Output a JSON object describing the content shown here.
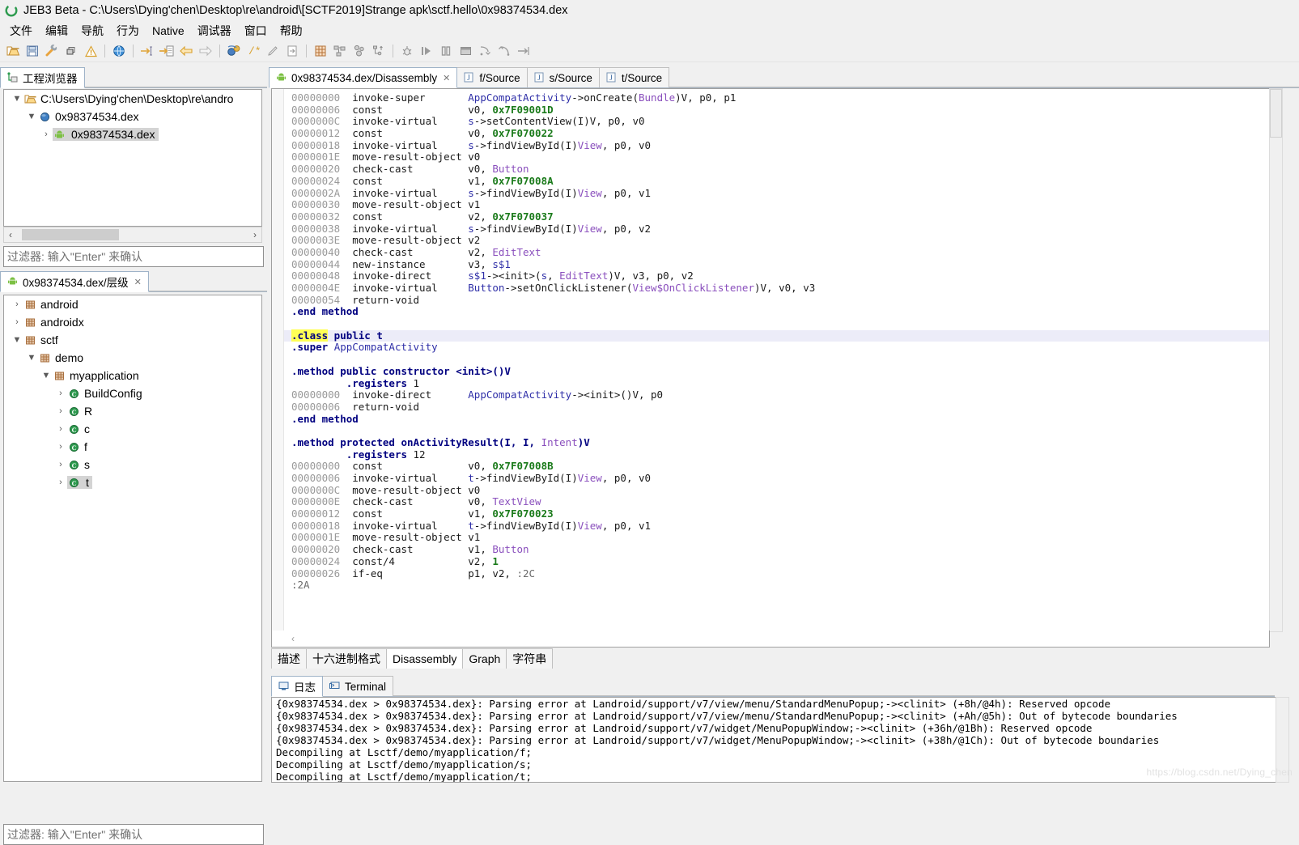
{
  "window": {
    "title": "JEB3 Beta - C:\\Users\\Dying'chen\\Desktop\\re\\android\\[SCTF2019]Strange apk\\sctf.hello\\0x98374534.dex",
    "logo_icon": "jeb-logo-icon"
  },
  "menu": {
    "items": [
      {
        "label": "文件",
        "name": "menu-file"
      },
      {
        "label": "编辑",
        "name": "menu-edit"
      },
      {
        "label": "导航",
        "name": "menu-navigation"
      },
      {
        "label": "行为",
        "name": "menu-action"
      },
      {
        "label": "Native",
        "name": "menu-native"
      },
      {
        "label": "调试器",
        "name": "menu-debugger"
      },
      {
        "label": "窗口",
        "name": "menu-window"
      },
      {
        "label": "帮助",
        "name": "menu-help"
      }
    ]
  },
  "toolbar": {
    "buttons": [
      {
        "name": "open-folder-icon",
        "title": "Open"
      },
      {
        "name": "save-icon",
        "title": "Save"
      },
      {
        "name": "wrench-icon",
        "title": "Options"
      },
      {
        "name": "windows-icon",
        "title": "Windows"
      },
      {
        "name": "warning-icon",
        "title": "Notifications"
      },
      {
        "name": "globe-icon",
        "title": "Web"
      },
      {
        "name": "goto-address-icon",
        "title": "Go to address"
      },
      {
        "name": "goto-document-icon",
        "title": "Go to document"
      },
      {
        "name": "back-arrow-icon",
        "title": "Back"
      },
      {
        "name": "forward-arrow-icon",
        "title": "Forward"
      },
      {
        "name": "decompile-icon",
        "title": "Decompile"
      },
      {
        "name": "comment-icon",
        "title": "Comment"
      },
      {
        "name": "rename-icon",
        "title": "Rename"
      },
      {
        "name": "export-icon",
        "title": "Export"
      },
      {
        "name": "grid-icon",
        "title": "Bytes"
      },
      {
        "name": "graph-icon",
        "title": "Graph"
      },
      {
        "name": "nodes-icon",
        "title": "Call graph"
      },
      {
        "name": "hierarchy-icon",
        "title": "Hierarchy"
      },
      {
        "name": "debug-bug-icon",
        "title": "Start debugger"
      },
      {
        "name": "run-icon",
        "title": "Run"
      },
      {
        "name": "pause-icon",
        "title": "Pause"
      },
      {
        "name": "stop-icon",
        "title": "Stop"
      },
      {
        "name": "step-into-icon",
        "title": "Step into"
      },
      {
        "name": "step-over-icon",
        "title": "Step over"
      },
      {
        "name": "step-out-icon",
        "title": "Step out"
      }
    ]
  },
  "project_panel": {
    "tab": {
      "label": "工程浏览器",
      "icon": "project-explorer-icon"
    },
    "tree": [
      {
        "indent": 0,
        "twist": "▼",
        "icon": "folder-icon",
        "label": "C:\\Users\\Dying'chen\\Desktop\\re\\andro",
        "selected": false
      },
      {
        "indent": 1,
        "twist": "▼",
        "icon": "blue-sphere-icon",
        "label": "0x98374534.dex",
        "selected": false
      },
      {
        "indent": 2,
        "twist": "›",
        "icon": "android-icon",
        "label": "0x98374534.dex",
        "selected": true
      }
    ],
    "filter_placeholder": "过滤器: 输入\"Enter\" 来确认"
  },
  "hierarchy_panel": {
    "tab": {
      "label": "0x98374534.dex/层级",
      "icon": "android-icon",
      "close": "✕"
    },
    "tree": [
      {
        "indent": 0,
        "twist": "›",
        "icon": "package-icon",
        "label": "android",
        "selected": false
      },
      {
        "indent": 0,
        "twist": "›",
        "icon": "package-icon",
        "label": "androidx",
        "selected": false
      },
      {
        "indent": 0,
        "twist": "▼",
        "icon": "package-icon",
        "label": "sctf",
        "selected": false
      },
      {
        "indent": 1,
        "twist": "▼",
        "icon": "package-icon",
        "label": "demo",
        "selected": false
      },
      {
        "indent": 2,
        "twist": "▼",
        "icon": "package-icon",
        "label": "myapplication",
        "selected": false
      },
      {
        "indent": 3,
        "twist": "›",
        "icon": "class-icon",
        "label": "BuildConfig",
        "selected": false
      },
      {
        "indent": 3,
        "twist": "›",
        "icon": "class-icon",
        "label": "R",
        "selected": false
      },
      {
        "indent": 3,
        "twist": "›",
        "icon": "class-icon",
        "label": "c",
        "selected": false
      },
      {
        "indent": 3,
        "twist": "›",
        "icon": "class-icon",
        "label": "f",
        "selected": false
      },
      {
        "indent": 3,
        "twist": "›",
        "icon": "class-icon",
        "label": "s",
        "selected": false
      },
      {
        "indent": 3,
        "twist": "›",
        "icon": "class-icon",
        "label": "t",
        "selected": true
      }
    ],
    "filter_placeholder": "过滤器: 输入\"Enter\" 来确认"
  },
  "editor": {
    "tabs": [
      {
        "label": "0x98374534.dex/Disassembly",
        "icon": "android-icon",
        "active": true,
        "close": "✕"
      },
      {
        "label": "f/Source",
        "icon": "java-source-icon",
        "active": false
      },
      {
        "label": "s/Source",
        "icon": "java-source-icon",
        "active": false
      },
      {
        "label": "t/Source",
        "icon": "java-source-icon",
        "active": false
      }
    ],
    "bottom_tabs": [
      {
        "label": "描述",
        "active": false
      },
      {
        "label": "十六进制格式",
        "active": false
      },
      {
        "label": "Disassembly",
        "active": true
      },
      {
        "label": "Graph",
        "active": false
      },
      {
        "label": "字符串",
        "active": false
      }
    ],
    "code": [
      {
        "addr": "00000000",
        "mnemonic": "invoke-super",
        "args": [
          {
            "t": "type",
            "v": "AppCompatActivity"
          },
          {
            "t": "op",
            "v": "->onCreate("
          },
          {
            "t": "cls",
            "v": "Bundle"
          },
          {
            "t": "op",
            "v": ")V, p0, p1"
          }
        ]
      },
      {
        "addr": "00000006",
        "mnemonic": "const",
        "args": [
          {
            "t": "op",
            "v": "v0, "
          },
          {
            "t": "num",
            "v": "0x7F09001D"
          }
        ]
      },
      {
        "addr": "0000000C",
        "mnemonic": "invoke-virtual",
        "args": [
          {
            "t": "type",
            "v": "s"
          },
          {
            "t": "op",
            "v": "->setContentView(I)V, p0, v0"
          }
        ]
      },
      {
        "addr": "00000012",
        "mnemonic": "const",
        "args": [
          {
            "t": "op",
            "v": "v0, "
          },
          {
            "t": "num",
            "v": "0x7F070022"
          }
        ]
      },
      {
        "addr": "00000018",
        "mnemonic": "invoke-virtual",
        "args": [
          {
            "t": "type",
            "v": "s"
          },
          {
            "t": "op",
            "v": "->findViewById(I)"
          },
          {
            "t": "cls",
            "v": "View"
          },
          {
            "t": "op",
            "v": ", p0, v0"
          }
        ]
      },
      {
        "addr": "0000001E",
        "mnemonic": "move-result-object",
        "args": [
          {
            "t": "op",
            "v": "v0"
          }
        ]
      },
      {
        "addr": "00000020",
        "mnemonic": "check-cast",
        "args": [
          {
            "t": "op",
            "v": "v0, "
          },
          {
            "t": "cls",
            "v": "Button"
          }
        ]
      },
      {
        "addr": "00000024",
        "mnemonic": "const",
        "args": [
          {
            "t": "op",
            "v": "v1, "
          },
          {
            "t": "num",
            "v": "0x7F07008A"
          }
        ]
      },
      {
        "addr": "0000002A",
        "mnemonic": "invoke-virtual",
        "args": [
          {
            "t": "type",
            "v": "s"
          },
          {
            "t": "op",
            "v": "->findViewById(I)"
          },
          {
            "t": "cls",
            "v": "View"
          },
          {
            "t": "op",
            "v": ", p0, v1"
          }
        ]
      },
      {
        "addr": "00000030",
        "mnemonic": "move-result-object",
        "args": [
          {
            "t": "op",
            "v": "v1"
          }
        ]
      },
      {
        "addr": "00000032",
        "mnemonic": "const",
        "args": [
          {
            "t": "op",
            "v": "v2, "
          },
          {
            "t": "num",
            "v": "0x7F070037"
          }
        ]
      },
      {
        "addr": "00000038",
        "mnemonic": "invoke-virtual",
        "args": [
          {
            "t": "type",
            "v": "s"
          },
          {
            "t": "op",
            "v": "->findViewById(I)"
          },
          {
            "t": "cls",
            "v": "View"
          },
          {
            "t": "op",
            "v": ", p0, v2"
          }
        ]
      },
      {
        "addr": "0000003E",
        "mnemonic": "move-result-object",
        "args": [
          {
            "t": "op",
            "v": "v2"
          }
        ]
      },
      {
        "addr": "00000040",
        "mnemonic": "check-cast",
        "args": [
          {
            "t": "op",
            "v": "v2, "
          },
          {
            "t": "cls",
            "v": "EditText"
          }
        ]
      },
      {
        "addr": "00000044",
        "mnemonic": "new-instance",
        "args": [
          {
            "t": "op",
            "v": "v3, "
          },
          {
            "t": "type",
            "v": "s$1"
          }
        ]
      },
      {
        "addr": "00000048",
        "mnemonic": "invoke-direct",
        "args": [
          {
            "t": "type",
            "v": "s$1"
          },
          {
            "t": "op",
            "v": "-><init>("
          },
          {
            "t": "type",
            "v": "s"
          },
          {
            "t": "op",
            "v": ", "
          },
          {
            "t": "cls",
            "v": "EditText"
          },
          {
            "t": "op",
            "v": ")V, v3, p0, v2"
          }
        ]
      },
      {
        "addr": "0000004E",
        "mnemonic": "invoke-virtual",
        "args": [
          {
            "t": "type",
            "v": "Button"
          },
          {
            "t": "op",
            "v": "->setOnClickListener("
          },
          {
            "t": "cls",
            "v": "View$OnClickListener"
          },
          {
            "t": "op",
            "v": ")V, v0, v3"
          }
        ]
      },
      {
        "addr": "00000054",
        "mnemonic": "return-void",
        "args": []
      },
      {
        "addr": "",
        "raw": [
          {
            "t": "dir",
            "v": ".end method"
          }
        ]
      },
      {
        "addr": "",
        "raw": []
      },
      {
        "addr": "",
        "hl": true,
        "raw": [
          {
            "t": "mark-dir",
            "v": ".class"
          },
          {
            "t": "dir",
            "v": " public t"
          }
        ]
      },
      {
        "addr": "",
        "raw": [
          {
            "t": "dir",
            "v": ".super "
          },
          {
            "t": "type",
            "v": "AppCompatActivity"
          }
        ]
      },
      {
        "addr": "",
        "raw": []
      },
      {
        "addr": "",
        "raw": [
          {
            "t": "dir",
            "v": ".method public constructor <init>()V"
          }
        ]
      },
      {
        "addr": "",
        "raw": [
          {
            "t": "indent",
            "v": "         "
          },
          {
            "t": "dir",
            "v": ".registers "
          },
          {
            "t": "op",
            "v": "1"
          }
        ]
      },
      {
        "addr": "00000000",
        "mnemonic": "invoke-direct",
        "args": [
          {
            "t": "type",
            "v": "AppCompatActivity"
          },
          {
            "t": "op",
            "v": "-><init>()V, p0"
          }
        ]
      },
      {
        "addr": "00000006",
        "mnemonic": "return-void",
        "args": []
      },
      {
        "addr": "",
        "raw": [
          {
            "t": "dir",
            "v": ".end method"
          }
        ]
      },
      {
        "addr": "",
        "raw": []
      },
      {
        "addr": "",
        "raw": [
          {
            "t": "dir",
            "v": ".method protected onActivityResult(I, I, "
          },
          {
            "t": "cls",
            "v": "Intent"
          },
          {
            "t": "dir",
            "v": ")V"
          }
        ]
      },
      {
        "addr": "",
        "raw": [
          {
            "t": "indent",
            "v": "         "
          },
          {
            "t": "dir",
            "v": ".registers "
          },
          {
            "t": "op",
            "v": "12"
          }
        ]
      },
      {
        "addr": "00000000",
        "mnemonic": "const",
        "args": [
          {
            "t": "op",
            "v": "v0, "
          },
          {
            "t": "num",
            "v": "0x7F07008B"
          }
        ]
      },
      {
        "addr": "00000006",
        "mnemonic": "invoke-virtual",
        "args": [
          {
            "t": "type",
            "v": "t"
          },
          {
            "t": "op",
            "v": "->findViewById(I)"
          },
          {
            "t": "cls",
            "v": "View"
          },
          {
            "t": "op",
            "v": ", p0, v0"
          }
        ]
      },
      {
        "addr": "0000000C",
        "mnemonic": "move-result-object",
        "args": [
          {
            "t": "op",
            "v": "v0"
          }
        ]
      },
      {
        "addr": "0000000E",
        "mnemonic": "check-cast",
        "args": [
          {
            "t": "op",
            "v": "v0, "
          },
          {
            "t": "cls",
            "v": "TextView"
          }
        ]
      },
      {
        "addr": "00000012",
        "mnemonic": "const",
        "args": [
          {
            "t": "op",
            "v": "v1, "
          },
          {
            "t": "num",
            "v": "0x7F070023"
          }
        ]
      },
      {
        "addr": "00000018",
        "mnemonic": "invoke-virtual",
        "args": [
          {
            "t": "type",
            "v": "t"
          },
          {
            "t": "op",
            "v": "->findViewById(I)"
          },
          {
            "t": "cls",
            "v": "View"
          },
          {
            "t": "op",
            "v": ", p0, v1"
          }
        ]
      },
      {
        "addr": "0000001E",
        "mnemonic": "move-result-object",
        "args": [
          {
            "t": "op",
            "v": "v1"
          }
        ]
      },
      {
        "addr": "00000020",
        "mnemonic": "check-cast",
        "args": [
          {
            "t": "op",
            "v": "v1, "
          },
          {
            "t": "cls",
            "v": "Button"
          }
        ]
      },
      {
        "addr": "00000024",
        "mnemonic": "const/4",
        "args": [
          {
            "t": "op",
            "v": "v2, "
          },
          {
            "t": "num",
            "v": "1"
          }
        ]
      },
      {
        "addr": "00000026",
        "mnemonic": "if-eq",
        "args": [
          {
            "t": "op",
            "v": "p1, v2, "
          },
          {
            "t": "lbl2",
            "v": ":2C"
          }
        ]
      },
      {
        "addr": "",
        "raw": [
          {
            "t": "lbl2",
            "v": ":2A"
          }
        ]
      }
    ]
  },
  "log_panel": {
    "tabs": [
      {
        "label": "日志",
        "icon": "log-icon",
        "active": true
      },
      {
        "label": "Terminal",
        "icon": "terminal-icon",
        "active": false
      }
    ],
    "lines": [
      "{0x98374534.dex > 0x98374534.dex}: Parsing error at Landroid/support/v7/view/menu/StandardMenuPopup;-><clinit> (+8h/@4h): Reserved opcode",
      "{0x98374534.dex > 0x98374534.dex}: Parsing error at Landroid/support/v7/view/menu/StandardMenuPopup;-><clinit> (+Ah/@5h): Out of bytecode boundaries",
      "{0x98374534.dex > 0x98374534.dex}: Parsing error at Landroid/support/v7/widget/MenuPopupWindow;-><clinit> (+36h/@1Bh): Reserved opcode",
      "{0x98374534.dex > 0x98374534.dex}: Parsing error at Landroid/support/v7/widget/MenuPopupWindow;-><clinit> (+38h/@1Ch): Out of bytecode boundaries",
      "Decompiling at Lsctf/demo/myapplication/f;",
      "Decompiling at Lsctf/demo/myapplication/s;",
      "Decompiling at Lsctf/demo/myapplication/t;"
    ]
  },
  "watermark": "https://blog.csdn.net/Dying_chen",
  "colors": {
    "accent_blue": "#2f2fa8",
    "class_purple": "#8a4fbd",
    "number_green": "#1a7a1a",
    "highlight_yellow": "#ffff55",
    "selection_gray": "#d4d4d4"
  }
}
